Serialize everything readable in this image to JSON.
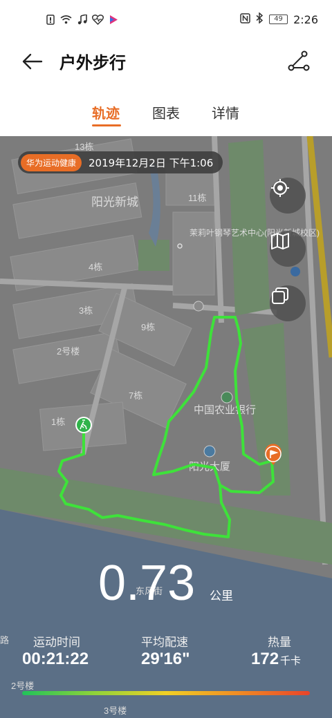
{
  "status_bar": {
    "time": "2:26",
    "battery": "49",
    "icons": [
      "sim-icon",
      "wifi-icon",
      "music-icon",
      "health-icon",
      "app-icon",
      "nfc-icon",
      "bluetooth-icon"
    ]
  },
  "header": {
    "title": "户外步行",
    "back_icon": "back-arrow-icon",
    "share_icon": "share-icon"
  },
  "tabs": [
    {
      "label": "轨迹",
      "active": true
    },
    {
      "label": "图表",
      "active": false
    },
    {
      "label": "详情",
      "active": false
    }
  ],
  "map": {
    "brand_badge": "华为运动健康",
    "datetime": "2019年12月2日 下午1:06",
    "labels": {
      "b13": "13栋",
      "complex": "阳光新城",
      "b11": "11栋",
      "center": "茉莉叶钢琴艺术中心(阳光新城校区)",
      "b4": "4栋",
      "b3": "3栋",
      "b9": "9栋",
      "b2": "2号楼",
      "b7": "7栋",
      "bank": "中国农业银行",
      "b1": "1栋",
      "tower": "阳光大厦",
      "road": "东风街",
      "road2": "路",
      "b2b": "2号楼",
      "b3b": "3号楼"
    },
    "buttons": [
      {
        "name": "locate-button",
        "icon": "crosshair-icon"
      },
      {
        "name": "map-type-button",
        "icon": "map-icon"
      },
      {
        "name": "layers-button",
        "icon": "layers-icon"
      }
    ],
    "route_color": "#3ee23a",
    "start_marker_color": "#2fb34a",
    "end_marker_color": "#e86d26"
  },
  "stats": {
    "distance": "0.73",
    "distance_unit": "公里",
    "duration_label": "运动时间",
    "duration": "00:21:22",
    "pace_label": "平均配速",
    "pace": "29'16\"",
    "calories_label": "热量",
    "calories": "172",
    "calories_unit": "千卡"
  },
  "colors": {
    "accent": "#e86d26"
  }
}
